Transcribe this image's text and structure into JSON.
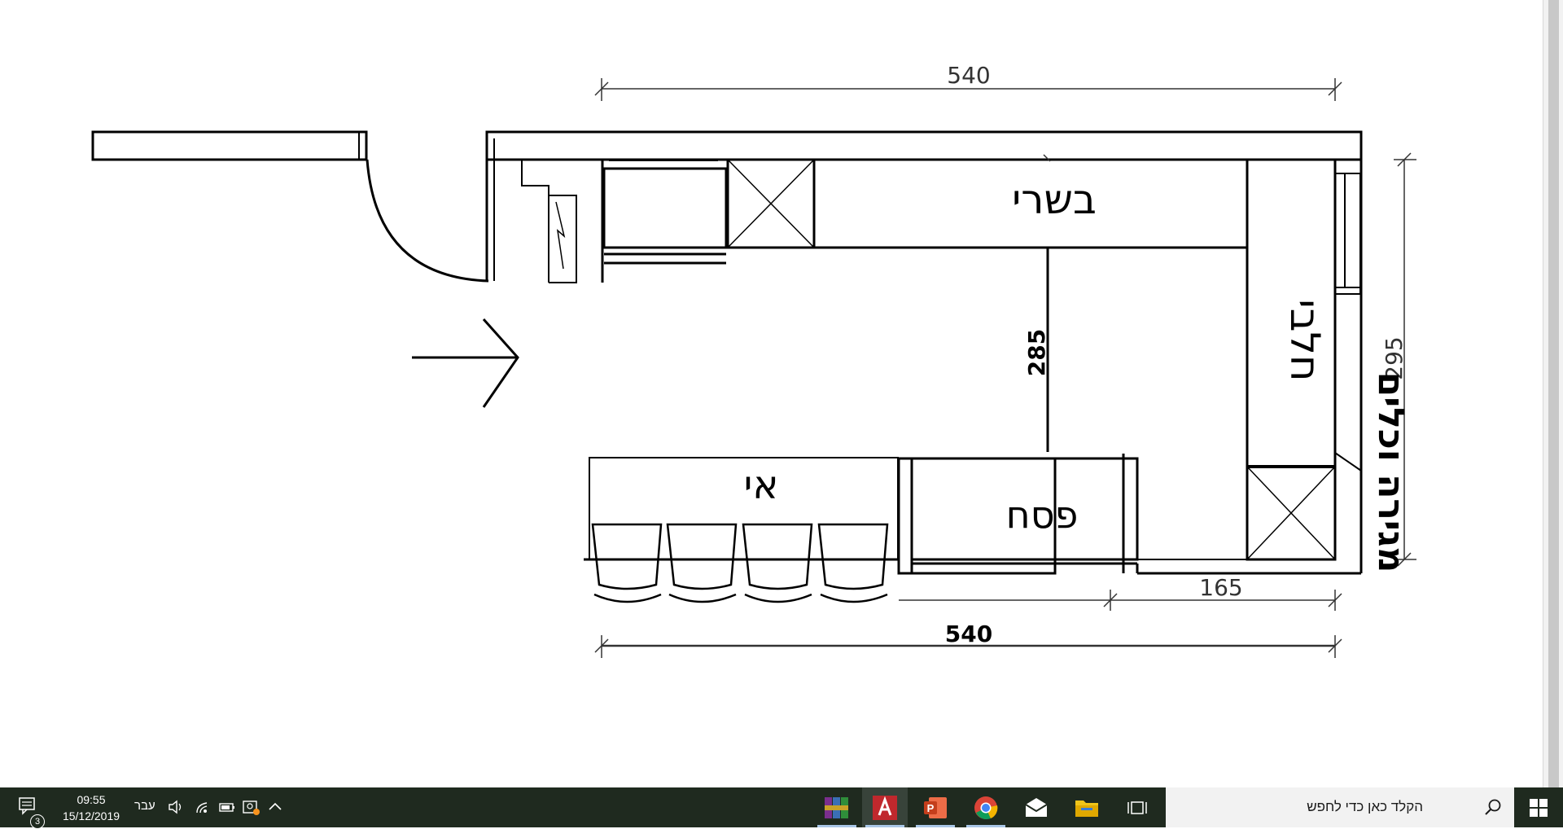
{
  "drawing": {
    "dim_top": "540",
    "dim_bottom": "540",
    "dim_right": "295",
    "dim_inner": "285",
    "dim_small": "165",
    "label_meat": "בשרי",
    "label_dairy": "חלבי",
    "label_passover": "פסח",
    "label_island": "אי",
    "label_right": "מגירה וכלים",
    "colors": {
      "line": "#000000",
      "dim_line": "#333333",
      "background": "#ffffff"
    }
  },
  "taskbar": {
    "notifications_count": "3",
    "time": "09:55",
    "date": "15/12/2019",
    "language": "עבר",
    "search_placeholder": "הקלד כאן כדי לחפש",
    "tray_icons": [
      "chevron-up-icon",
      "meet-now-icon",
      "battery-icon",
      "wifi-icon",
      "volume-icon"
    ],
    "apps": [
      {
        "name": "winrar-app",
        "running": true
      },
      {
        "name": "autocad-app",
        "running": true,
        "active": true
      },
      {
        "name": "powerpoint-app",
        "running": true
      },
      {
        "name": "chrome-app",
        "running": true
      },
      {
        "name": "mail-app",
        "running": false
      },
      {
        "name": "file-explorer-app",
        "running": false
      },
      {
        "name": "task-view",
        "running": false
      }
    ],
    "colors": {
      "taskbar": "#1f2a1f",
      "search_bg": "#f2f2f2",
      "active_app": "#38433a",
      "indicator": "#a9c6e6"
    }
  }
}
